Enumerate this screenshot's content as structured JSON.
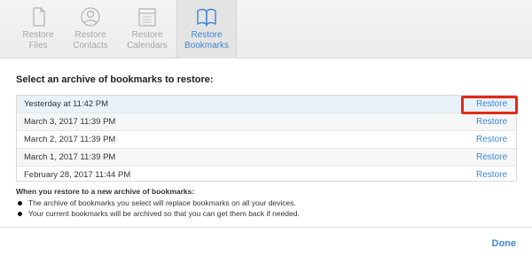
{
  "toolbar": {
    "tabs": [
      {
        "line1": "Restore",
        "line2": "Files",
        "icon": "file-icon"
      },
      {
        "line1": "Restore",
        "line2": "Contacts",
        "icon": "contacts-icon"
      },
      {
        "line1": "Restore",
        "line2": "Calendars",
        "icon": "calendar-icon"
      },
      {
        "line1": "Restore",
        "line2": "Bookmarks",
        "icon": "book-icon"
      }
    ]
  },
  "main": {
    "heading": "Select an archive of bookmarks to restore:",
    "rows": [
      {
        "date": "Yesterday at 11:42 PM",
        "action": "Restore"
      },
      {
        "date": "March 3, 2017 11:39 PM",
        "action": "Restore"
      },
      {
        "date": "March 2, 2017 11:39 PM",
        "action": "Restore"
      },
      {
        "date": "March 1, 2017 11:39 PM",
        "action": "Restore"
      },
      {
        "date": "February 28, 2017 11:44 PM",
        "action": "Restore"
      }
    ]
  },
  "notes": {
    "title": "When you restore to a new archive of bookmarks:",
    "items": [
      "The archive of bookmarks you select will replace bookmarks on all your devices.",
      "Your current bookmarks will be archived so that you can get them back if needed."
    ]
  },
  "footer": {
    "done_label": "Done"
  },
  "colors": {
    "accent": "#3d87d8",
    "highlight": "#e12b16"
  }
}
